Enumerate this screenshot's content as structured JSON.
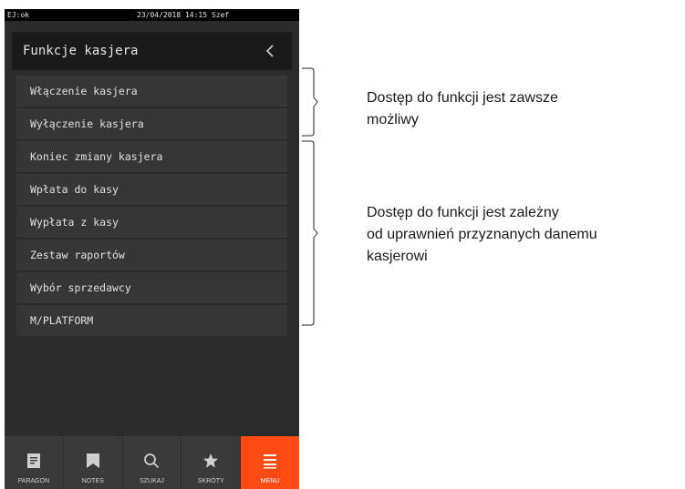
{
  "statusbar": {
    "left": "EJ:ok",
    "center": "23/04/2018 14:15 Szef"
  },
  "header": {
    "title": "Funkcje kasjera",
    "back_icon": "chevron-left-icon"
  },
  "menu": {
    "items": [
      {
        "label": "Włączenie kasjera"
      },
      {
        "label": "Wyłączenie kasjera"
      },
      {
        "label": "Koniec zmiany kasjera"
      },
      {
        "label": "Wpłata do kasy"
      },
      {
        "label": "Wypłata z kasy"
      },
      {
        "label": "Zestaw raportów"
      },
      {
        "label": "Wybór sprzedawcy"
      },
      {
        "label": "M/PLATFORM"
      }
    ]
  },
  "bottomnav": {
    "items": [
      {
        "label": "PARAGON",
        "icon": "receipt-icon"
      },
      {
        "label": "NOTES",
        "icon": "bookmark-icon"
      },
      {
        "label": "SZUKAJ",
        "icon": "search-icon"
      },
      {
        "label": "SKRÓTY",
        "icon": "star-icon"
      },
      {
        "label": "MENU",
        "icon": "menu-icon"
      }
    ],
    "active_color": "#ff4a14"
  },
  "annotations": {
    "first": {
      "line1": "Dostęp do funkcji jest zawsze",
      "line2": "możliwy"
    },
    "second": {
      "line1": "Dostęp do funkcji jest zależny",
      "line2": "od uprawnień przyznanych danemu",
      "line3": "kasjerowi"
    }
  }
}
